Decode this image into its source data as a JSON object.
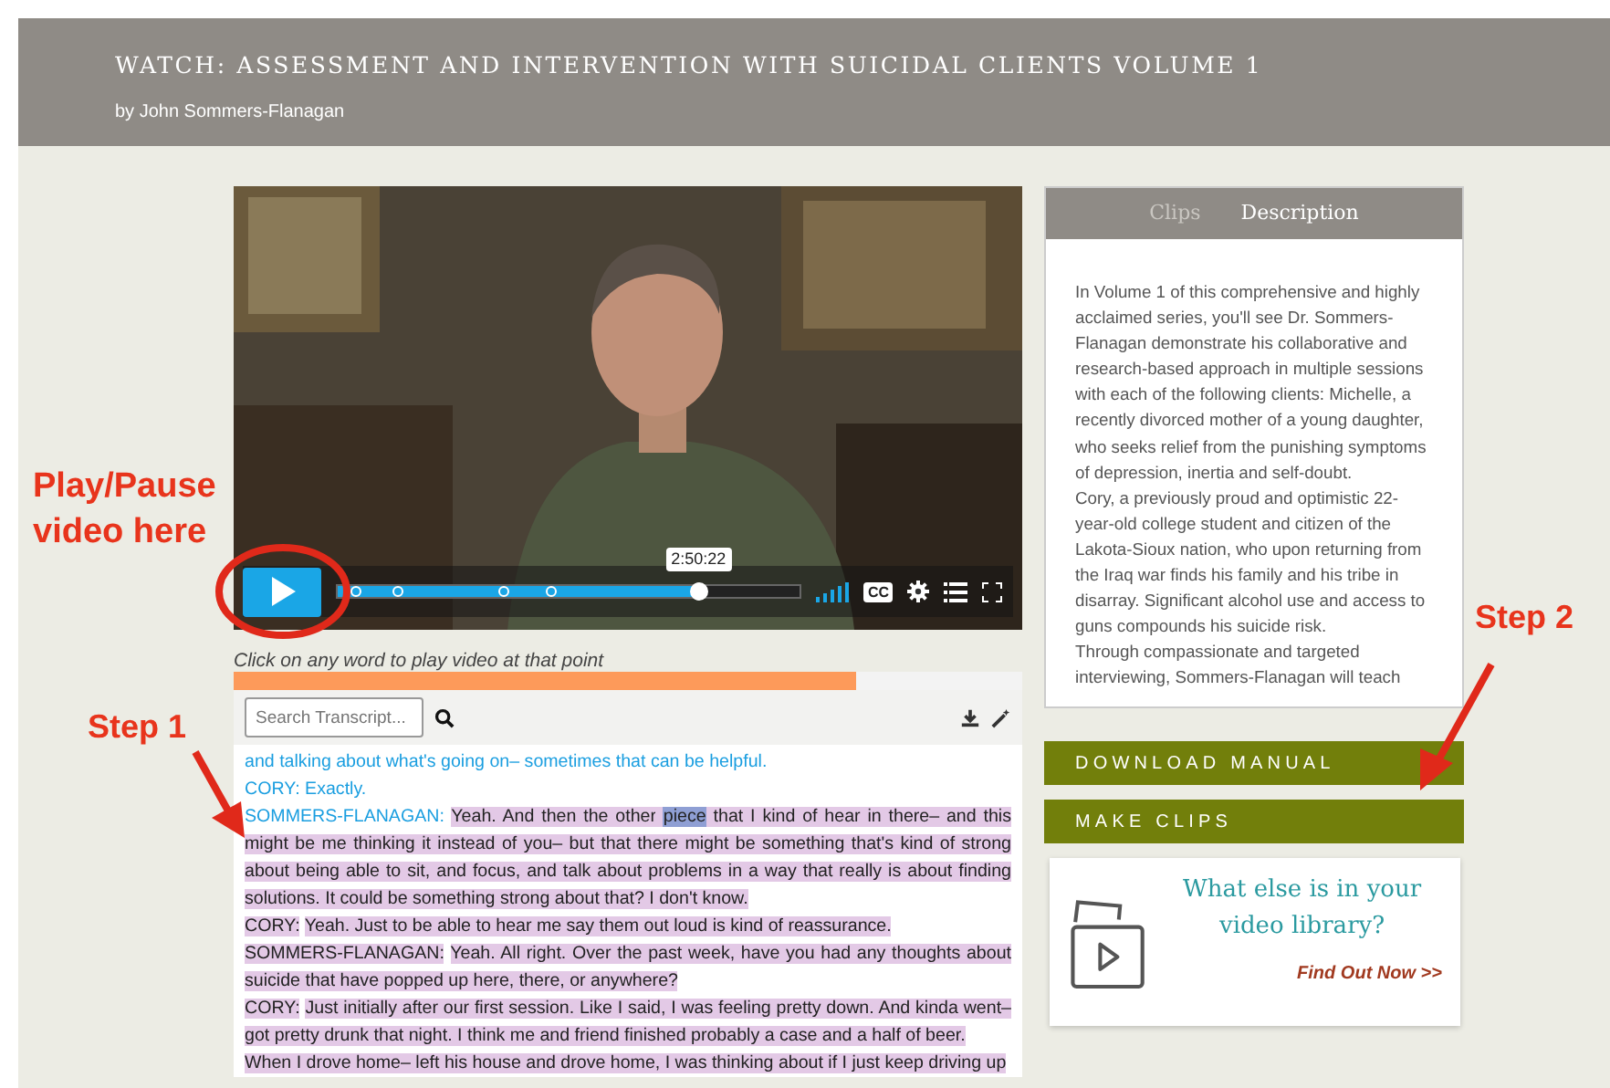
{
  "header": {
    "title": "WATCH: ASSESSMENT AND INTERVENTION WITH SUICIDAL CLIENTS VOLUME 1",
    "byline": "by John Sommers-Flanagan"
  },
  "video": {
    "playing": false,
    "progress": {
      "level": 0.78
    },
    "time_tooltip": "2:50:22",
    "captions_label": "CC"
  },
  "transcript": {
    "hint": "Click on any word to play video at that point",
    "load_bar": {
      "level": 0.79
    },
    "search": {
      "placeholder": "Search Transcript..."
    },
    "segments": [
      {
        "parts": [
          {
            "text": "and talking about what's going on– sometimes that can be helpful.",
            "played": true,
            "current": false
          }
        ]
      },
      {
        "speaker": "CORY:",
        "speaker_played": true,
        "parts": [
          {
            "text": "Exactly.",
            "played": true,
            "current": false
          }
        ]
      },
      {
        "speaker": "SOMMERS-FLANAGAN:",
        "speaker_played": true,
        "parts": [
          {
            "text": "Yeah. And then the other",
            "played": false,
            "current": false
          },
          {
            "text": "piece",
            "played": false,
            "current": true
          },
          {
            "text": "that I kind of hear in there– and this might be me thinking it instead of you– but that there might be something that's kind of strong about being able to sit, and focus, and talk about problems in a way that really is about finding solutions. It could be something strong about that? I don't know.",
            "played": false,
            "current": false
          }
        ]
      },
      {
        "speaker": "CORY:",
        "speaker_played": false,
        "parts": [
          {
            "text": "Yeah. Just to be able to hear me say them out loud is kind of reassurance.",
            "played": false,
            "current": false
          }
        ]
      },
      {
        "speaker": "SOMMERS-FLANAGAN:",
        "speaker_played": false,
        "parts": [
          {
            "text": "Yeah. All right. Over the past week, have you had any thoughts about suicide that have popped up here, there, or anywhere?",
            "played": false,
            "current": false
          }
        ]
      },
      {
        "speaker": "CORY:",
        "speaker_played": false,
        "parts": [
          {
            "text": "Just initially after our first session. Like I said, I was feeling pretty down. And kinda went– got pretty drunk that night. I think me and friend finished probably a case and a half of beer.",
            "played": false,
            "current": false
          }
        ]
      },
      {
        "parts": [
          {
            "text": "When I drove home– left his house and drove home, I was thinking about if I just keep driving up",
            "played": false,
            "current": false
          }
        ]
      }
    ]
  },
  "side_panel": {
    "tabs": [
      {
        "label": "Clips",
        "selected": false
      },
      {
        "label": "Description",
        "selected": true
      }
    ],
    "description": [
      "In Volume 1 of this comprehensive and highly acclaimed series, you'll see Dr. Sommers-Flanagan demonstrate his collaborative and research-based approach in multiple sessions with each of the following clients: Michelle, a recently divorced mother of a young daughter, who seeks relief from the punishing symptoms of depression, inertia and self-doubt.",
      "Cory, a previously proud and optimistic 22-year-old college student and citizen of the Lakota-Sioux nation, who upon returning from the Iraq war finds his family and his tribe in disarray. Significant alcohol use and access to guns compounds his suicide risk.",
      "Through compassionate and targeted interviewing, Sommers-Flanagan will teach"
    ]
  },
  "buttons": [
    "DOWNLOAD MANUAL",
    "MAKE CLIPS"
  ],
  "promo": {
    "headline": "What else is in your video library?",
    "link": "Find Out Now >>"
  },
  "annotations": [
    {
      "text": "Play/Pause video here"
    },
    {
      "text": "Step 1"
    },
    {
      "text": "Step 2"
    }
  ]
}
